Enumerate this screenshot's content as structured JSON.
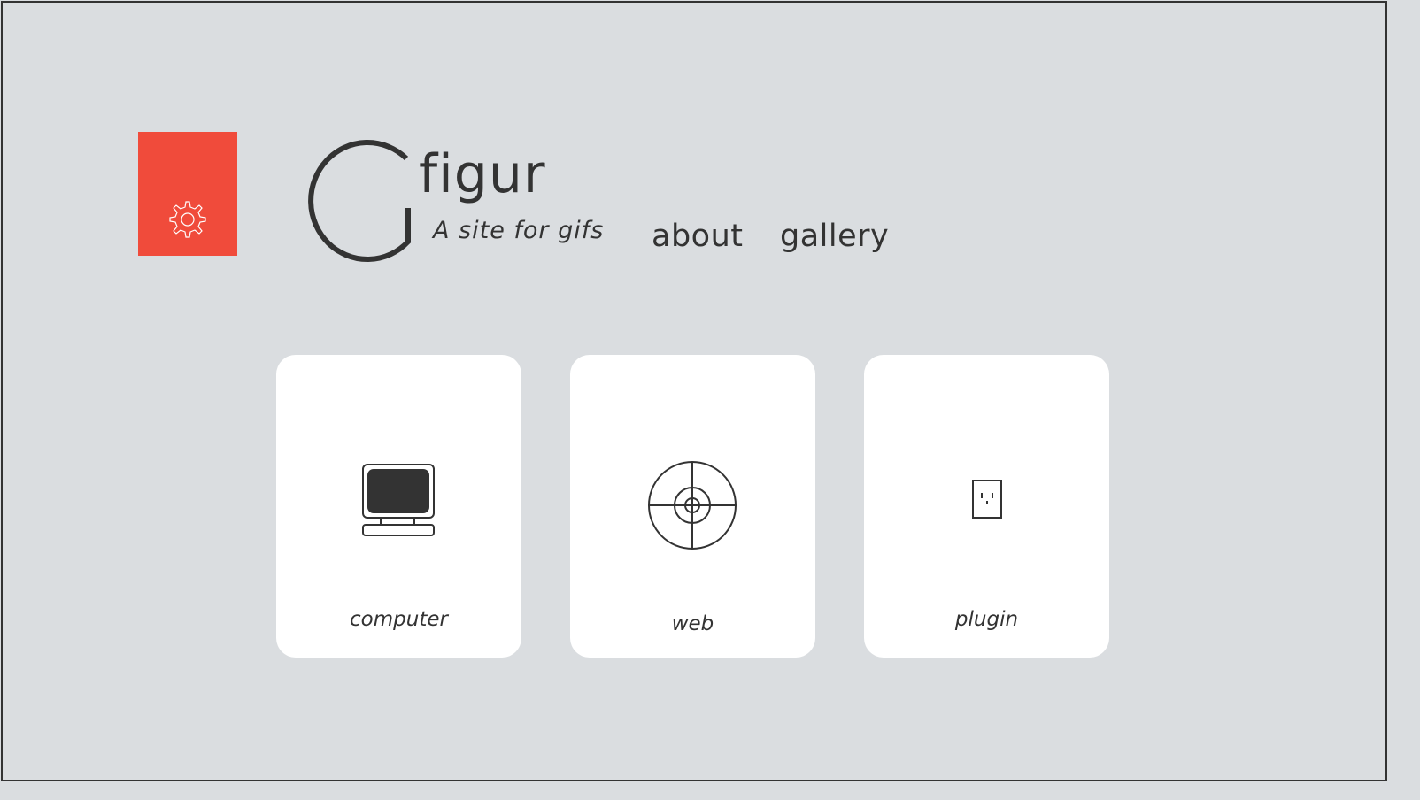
{
  "header": {
    "brand_name": "figur",
    "tagline": "A site for gifs",
    "settings_icon": "gear-icon"
  },
  "nav": {
    "items": [
      {
        "label": "about"
      },
      {
        "label": "gallery"
      }
    ]
  },
  "cards": [
    {
      "label": "computer",
      "icon": "computer-icon"
    },
    {
      "label": "web",
      "icon": "crosshair-globe-icon"
    },
    {
      "label": "plugin",
      "icon": "power-outlet-icon"
    }
  ],
  "colors": {
    "background": "#dadde0",
    "accent": "#f04b3b",
    "text": "#333333",
    "card": "#ffffff"
  }
}
